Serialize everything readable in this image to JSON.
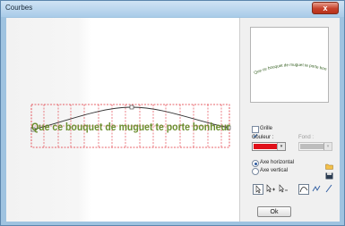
{
  "window": {
    "title": "Courbes",
    "close_symbol": "x"
  },
  "canvas": {
    "text": "Que ce bouquet de muguet te porte bonheur",
    "text_color": "#6b8e2f",
    "grid_color": "#e0303a"
  },
  "preview": {
    "text": "Que ce bouquet de muguet te porte bonheur"
  },
  "options": {
    "grid_label": "Grille",
    "grid_checked": true,
    "color_label": "Couleur :",
    "color_value": "#e0101a",
    "background_label": "Fond :",
    "background_value": "#bdbdbd",
    "axis_horizontal_label": "Axe horizontal",
    "axis_vertical_label": "Axe vertical",
    "axis_selected": "horizontal"
  },
  "icons": {
    "folder": "folder-open-icon",
    "save": "floppy-disk-icon",
    "select": "pointer-select-icon",
    "add_point": "add-point-icon",
    "remove_point": "remove-point-icon",
    "curve": "curve-icon",
    "smooth": "smooth-line-icon",
    "straight": "straight-line-icon"
  },
  "buttons": {
    "ok_label": "Ok"
  }
}
